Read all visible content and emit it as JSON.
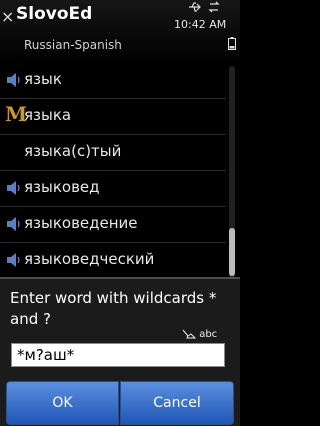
{
  "header": {
    "title": "SlovoEd",
    "subtitle": "Russian-Spanish",
    "time": "10:42 AM",
    "close_symbol": "×"
  },
  "list": {
    "items": [
      {
        "label": "язык",
        "icon": "speaker-icon"
      },
      {
        "label": "языка",
        "icon": "morphology-m-icon",
        "icon_text": "M"
      },
      {
        "label": "языка(с)тый",
        "icon": ""
      },
      {
        "label": "языковед",
        "icon": "speaker-icon"
      },
      {
        "label": "языковедение",
        "icon": "speaker-icon"
      },
      {
        "label": "языковедческий",
        "icon": "speaker-icon"
      }
    ]
  },
  "dialog": {
    "prompt": "Enter word with wildcards * and ?",
    "input_mode": "abc",
    "input_value": "*м?аш*",
    "ok_label": "OK",
    "cancel_label": "Cancel"
  },
  "colors": {
    "button_gradient_top": "#5a8fe0",
    "button_gradient_bottom": "#1f56b4",
    "morph_icon": "#c89a2a",
    "speaker_icon": "#5b7fc4"
  }
}
